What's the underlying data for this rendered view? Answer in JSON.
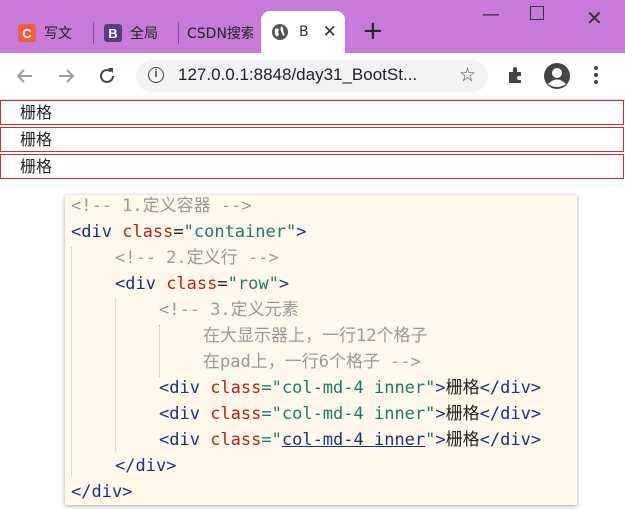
{
  "browser": {
    "tabs": [
      {
        "icon_letter": "C",
        "title": "写文",
        "icon_color": "#f25d3a"
      },
      {
        "icon_letter": "B",
        "title": "全局",
        "icon_color": "#563d7c"
      },
      {
        "icon_letter": "",
        "title": "CSDN搜索",
        "icon_color": ""
      }
    ],
    "active_tab": {
      "title": "B",
      "icon": "globe-icon"
    },
    "new_tab_label": "+",
    "url": "127.0.0.1:8848/day31_BootSt..."
  },
  "page": {
    "cells": [
      "栅格",
      "栅格",
      "栅格"
    ]
  },
  "code": {
    "line1": "<!-- 1.定义容器 -->",
    "line2_tag": "<div ",
    "line2_attr": "class",
    "line2_eq": "=",
    "line2_val": "\"container\"",
    "line2_end": ">",
    "line3": "<!-- 2.定义行 -->",
    "line4_tag": "<div ",
    "line4_attr": "class",
    "line4_eq": "=",
    "line4_val": "\"row\"",
    "line4_end": ">",
    "line5": "<!-- 3.定义元素",
    "line6": "在大显示器上，一行12个格子",
    "line7": "在pad上，一行6个格子 -->",
    "col_open_tag": "<div ",
    "col_attr": "class",
    "col_eq": "=\"",
    "col_val": "col-md-4 inner",
    "col_q": "\"",
    "col_gt": ">",
    "col_text": "栅格",
    "col_close": "</div>",
    "line11": "</div>",
    "line12": "</div>"
  }
}
